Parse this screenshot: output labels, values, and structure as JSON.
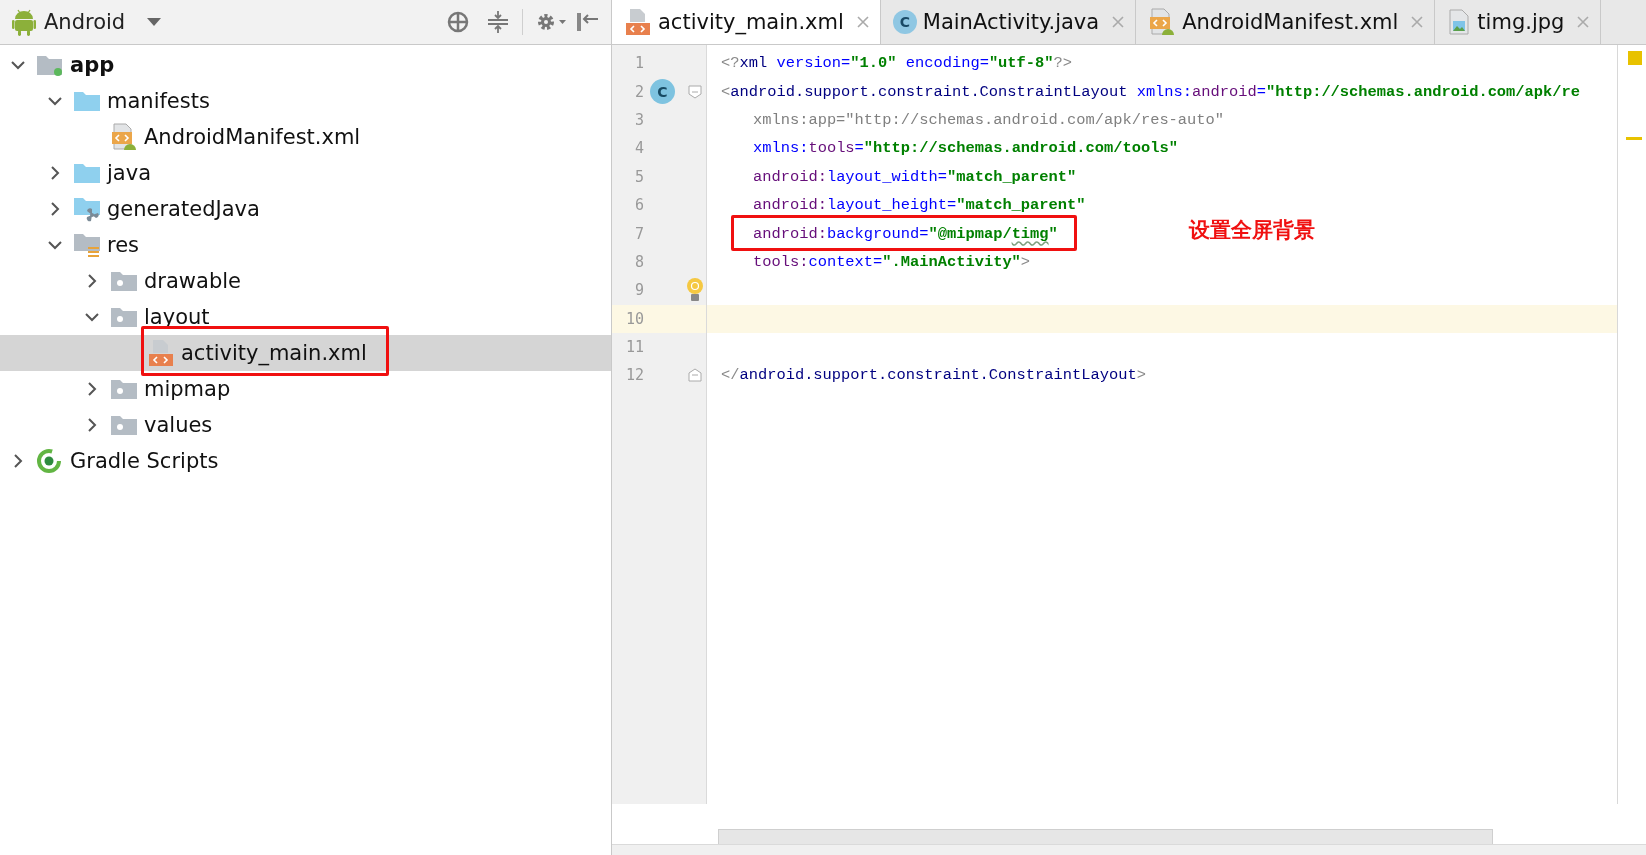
{
  "project_view": {
    "title": "Android",
    "tree": [
      {
        "label": "app",
        "kind": "module",
        "expanded": true,
        "selected": false,
        "annotated": false,
        "children": [
          {
            "label": "manifests",
            "kind": "folder",
            "expanded": true,
            "selected": false,
            "annotated": false,
            "children": [
              {
                "label": "AndroidManifest.xml",
                "kind": "manifest",
                "selected": false,
                "annotated": false
              }
            ]
          },
          {
            "label": "java",
            "kind": "folder",
            "expanded": false,
            "selected": false,
            "annotated": false
          },
          {
            "label": "generatedJava",
            "kind": "generated",
            "expanded": false,
            "selected": false,
            "annotated": false
          },
          {
            "label": "res",
            "kind": "res",
            "expanded": true,
            "selected": false,
            "annotated": false,
            "children": [
              {
                "label": "drawable",
                "kind": "resdir",
                "expanded": false,
                "selected": false,
                "annotated": false
              },
              {
                "label": "layout",
                "kind": "resdir",
                "expanded": true,
                "selected": false,
                "annotated": false,
                "children": [
                  {
                    "label": "activity_main.xml",
                    "kind": "layout",
                    "selected": true,
                    "annotated": true
                  }
                ]
              },
              {
                "label": "mipmap",
                "kind": "resdir",
                "expanded": false,
                "selected": false,
                "annotated": false
              },
              {
                "label": "values",
                "kind": "resdir",
                "expanded": false,
                "selected": false,
                "annotated": false
              }
            ]
          }
        ]
      },
      {
        "label": "Gradle Scripts",
        "kind": "gradle",
        "expanded": false,
        "selected": false,
        "annotated": false
      }
    ]
  },
  "editor": {
    "tabs": [
      {
        "label": "activity_main.xml",
        "kind": "layout",
        "selected": true
      },
      {
        "label": "MainActivity.java",
        "kind": "class",
        "badge": "C",
        "selected": false
      },
      {
        "label": "AndroidManifest.xml",
        "kind": "manifest",
        "selected": false
      },
      {
        "label": "timg.jpg",
        "kind": "image",
        "selected": false
      }
    ],
    "annotation": "设置全屏背景",
    "lines": [
      {
        "number": "1",
        "kind": "prolog",
        "current": false,
        "annotated": false,
        "bulb": false,
        "tokens": [
          {
            "text": "<?",
            "kind": "punct"
          },
          {
            "text": "xml",
            "kind": "tag"
          },
          {
            "text": " version=",
            "kind": "attr"
          },
          {
            "text": "\"1.0\"",
            "kind": "value"
          },
          {
            "text": " encoding=",
            "kind": "attr"
          },
          {
            "text": "\"utf-8\"",
            "kind": "value"
          },
          {
            "text": "?>",
            "kind": "punct"
          }
        ]
      },
      {
        "number": "2",
        "kind": "open-tag",
        "current": false,
        "annotated": false,
        "bulb": false,
        "badge": "C",
        "tokens": [
          {
            "text": "<",
            "kind": "punct"
          },
          {
            "text": "android.support.constraint.ConstraintLayout",
            "kind": "tag"
          },
          {
            "text": " xmlns:",
            "kind": "attr"
          },
          {
            "text": "android",
            "kind": "ns"
          },
          {
            "text": "=",
            "kind": "attr"
          },
          {
            "text": "\"http://schemas.android.com/apk/re",
            "kind": "value"
          }
        ]
      },
      {
        "number": "3",
        "kind": "attribute",
        "current": false,
        "annotated": false,
        "bulb": false,
        "tokens": [
          {
            "text": "xmlns:app=\"http://schemas.android.com/apk/res-auto\"",
            "kind": "unused"
          }
        ]
      },
      {
        "number": "4",
        "kind": "attribute",
        "current": false,
        "annotated": false,
        "bulb": false,
        "tokens": [
          {
            "text": "xmlns:",
            "kind": "attr"
          },
          {
            "text": "tools",
            "kind": "ns"
          },
          {
            "text": "=",
            "kind": "attr"
          },
          {
            "text": "\"http://schemas.android.com/tools\"",
            "kind": "value"
          }
        ]
      },
      {
        "number": "5",
        "kind": "attribute",
        "current": false,
        "annotated": false,
        "bulb": false,
        "tokens": [
          {
            "text": "android:",
            "kind": "ns"
          },
          {
            "text": "layout_width=",
            "kind": "attr"
          },
          {
            "text": "\"match_parent\"",
            "kind": "value"
          }
        ]
      },
      {
        "number": "6",
        "kind": "attribute",
        "current": false,
        "annotated": false,
        "bulb": false,
        "tokens": [
          {
            "text": "android:",
            "kind": "ns"
          },
          {
            "text": "layout_height=",
            "kind": "attr"
          },
          {
            "text": "\"match_parent\"",
            "kind": "value"
          }
        ]
      },
      {
        "number": "7",
        "kind": "attribute",
        "current": false,
        "annotated": true,
        "bulb": false,
        "tokens": [
          {
            "text": "android:",
            "kind": "ns"
          },
          {
            "text": "background=",
            "kind": "attr"
          },
          {
            "text": "\"@mipmap/",
            "kind": "value"
          },
          {
            "text": "timg",
            "kind": "typo"
          },
          {
            "text": "\"",
            "kind": "value"
          }
        ]
      },
      {
        "number": "8",
        "kind": "attribute",
        "current": false,
        "annotated": false,
        "bulb": false,
        "tokens": [
          {
            "text": "tools:",
            "kind": "ns"
          },
          {
            "text": "context=",
            "kind": "attr"
          },
          {
            "text": "\".MainActivity\"",
            "kind": "value"
          },
          {
            "text": ">",
            "kind": "punct"
          }
        ]
      },
      {
        "number": "9",
        "kind": "blank",
        "current": false,
        "annotated": false,
        "bulb": true
      },
      {
        "number": "10",
        "kind": "blank",
        "current": true,
        "annotated": false,
        "bulb": false
      },
      {
        "number": "11",
        "kind": "blank",
        "current": false,
        "annotated": false,
        "bulb": false
      },
      {
        "number": "12",
        "kind": "close-tag",
        "current": false,
        "annotated": false,
        "bulb": false,
        "tokens": [
          {
            "text": "</",
            "kind": "punct"
          },
          {
            "text": "android.support.constraint.ConstraintLayout",
            "kind": "tag"
          },
          {
            "text": ">",
            "kind": "punct"
          }
        ]
      }
    ]
  }
}
